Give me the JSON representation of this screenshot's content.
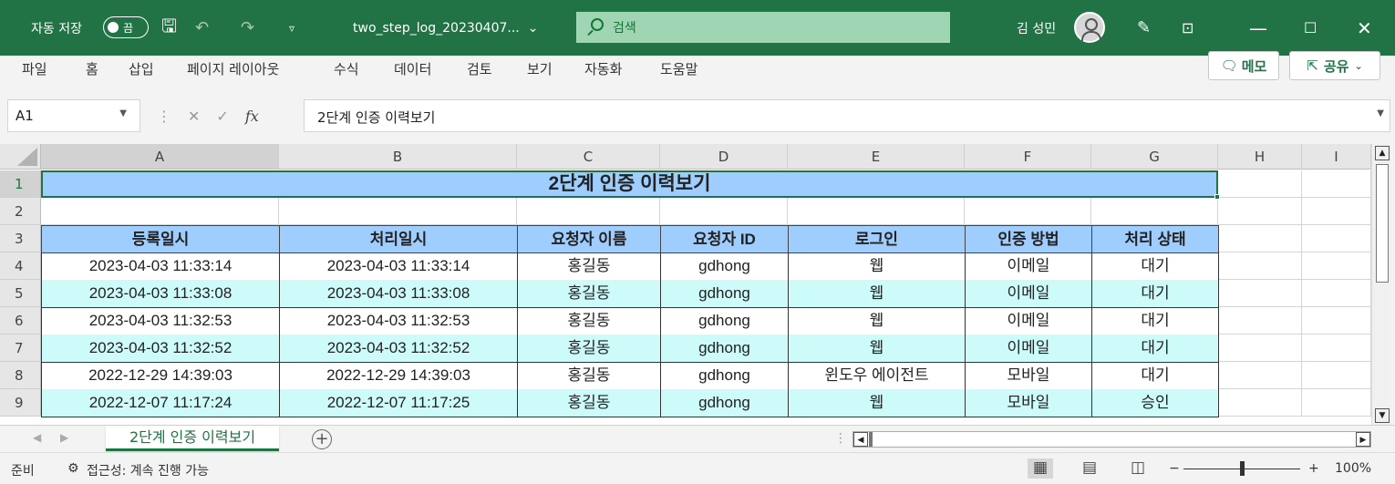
{
  "titlebar": {
    "autosave_label": "자동 저장",
    "autosave_state": "끔",
    "filename": "two_step_log_20230407...",
    "search_placeholder": "검색",
    "username": "김 성민",
    "undo_icon": "↶",
    "redo_icon": "↷",
    "qat_more": "▿",
    "min": "—",
    "max": "☐",
    "close": "✕"
  },
  "menu": [
    "파일",
    "홈",
    "삽입",
    "페이지 레이아웃",
    "수식",
    "데이터",
    "검토",
    "보기",
    "자동화",
    "도움말"
  ],
  "ribbon_buttons": {
    "memo": "메모",
    "share": "공유"
  },
  "formula_bar": {
    "cell_ref": "A1",
    "content": "2단계 인증 이력보기"
  },
  "columns": [
    "A",
    "B",
    "C",
    "D",
    "E",
    "F",
    "G",
    "H",
    "I"
  ],
  "rows": [
    "1",
    "2",
    "3",
    "4",
    "5",
    "6",
    "7",
    "8",
    "9"
  ],
  "sheet": {
    "title": "2단계 인증 이력보기",
    "headers": [
      "등록일시",
      "처리일시",
      "요청자 이름",
      "요청자 ID",
      "로그인",
      "인증 방법",
      "처리 상태"
    ],
    "data": [
      [
        "2023-04-03  11:33:14",
        "2023-04-03  11:33:14",
        "홍길동",
        "gdhong",
        "웹",
        "이메일",
        "대기"
      ],
      [
        "2023-04-03  11:33:08",
        "2023-04-03  11:33:08",
        "홍길동",
        "gdhong",
        "웹",
        "이메일",
        "대기"
      ],
      [
        "2023-04-03  11:32:53",
        "2023-04-03  11:32:53",
        "홍길동",
        "gdhong",
        "웹",
        "이메일",
        "대기"
      ],
      [
        "2023-04-03  11:32:52",
        "2023-04-03  11:32:52",
        "홍길동",
        "gdhong",
        "웹",
        "이메일",
        "대기"
      ],
      [
        "2022-12-29  14:39:03",
        "2022-12-29  14:39:03",
        "홍길동",
        "gdhong",
        "윈도우 에이전트",
        "모바일",
        "대기"
      ],
      [
        "2022-12-07  11:17:24",
        "2022-12-07  11:17:25",
        "홍길동",
        "gdhong",
        "웹",
        "모바일",
        "승인"
      ]
    ]
  },
  "sheet_tabs": {
    "active": "2단계 인증 이력보기"
  },
  "status": {
    "ready": "준비",
    "accessibility": "접근성: 계속 진행 가능",
    "zoom": "100%"
  },
  "colors": {
    "excel_green": "#217346",
    "header_blue": "#9fcdfe",
    "alt_row": "#ccfbfa"
  }
}
